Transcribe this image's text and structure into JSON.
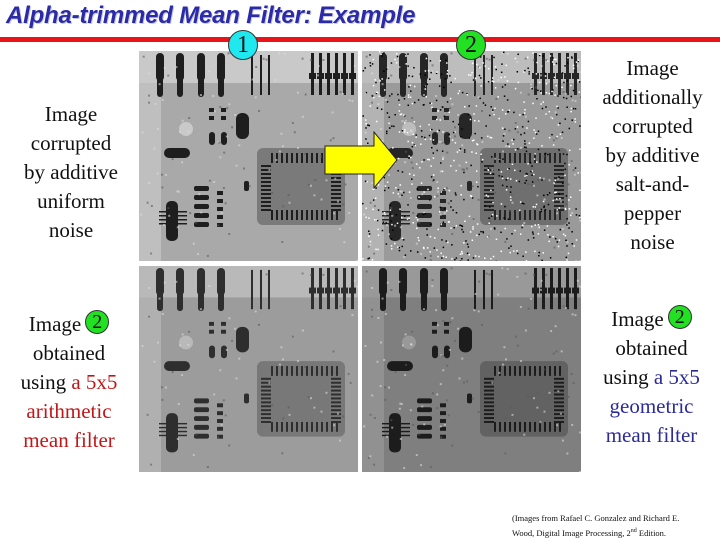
{
  "title": "Alpha-trimmed Mean Filter: Example",
  "badges": {
    "one": "1",
    "two": "2"
  },
  "labels": {
    "top_left": [
      "Image",
      "corrupted",
      "by additive",
      "uniform",
      "noise"
    ],
    "top_right": [
      "Image",
      "additionally",
      "corrupted",
      "by additive",
      "salt-and-",
      "pepper",
      "noise"
    ],
    "bottom_left": {
      "line1": "Image",
      "badge": "2",
      "line2": "obtained",
      "line3_plain": "using ",
      "line3_colored": "a 5x5",
      "line4": "arithmetic",
      "line5": "mean filter"
    },
    "bottom_right": {
      "line1": "Image",
      "badge": "2",
      "line2": "obtained",
      "line3_plain": "using ",
      "line3_colored": "a 5x5",
      "line4": "geometric",
      "line5": "mean filter"
    }
  },
  "images": [
    {
      "name": "uniform-noise-image",
      "description": "circuit board X-ray corrupted by uniform noise"
    },
    {
      "name": "salt-pepper-noise-image",
      "description": "circuit board X-ray with uniform and salt-and-pepper noise"
    },
    {
      "name": "arithmetic-mean-result",
      "description": "result of 5x5 arithmetic mean filter"
    },
    {
      "name": "geometric-mean-result",
      "description": "result of 5x5 geometric mean filter"
    }
  ],
  "footnote": {
    "line1": "(Images from Rafael C. Gonzalez and Richard E.",
    "line2_pre": "Wood, Digital Image Processing, 2",
    "line2_sup": "nd",
    "line2_post": " Edition."
  },
  "colors": {
    "title": "#2b2ba8",
    "rule": "#e8141a",
    "badge_one": "#1fe8ef",
    "badge_two": "#22e022",
    "arithmetic_text": "#c01818",
    "geometric_text": "#2b2b9a",
    "arrow": "#ffff00"
  }
}
